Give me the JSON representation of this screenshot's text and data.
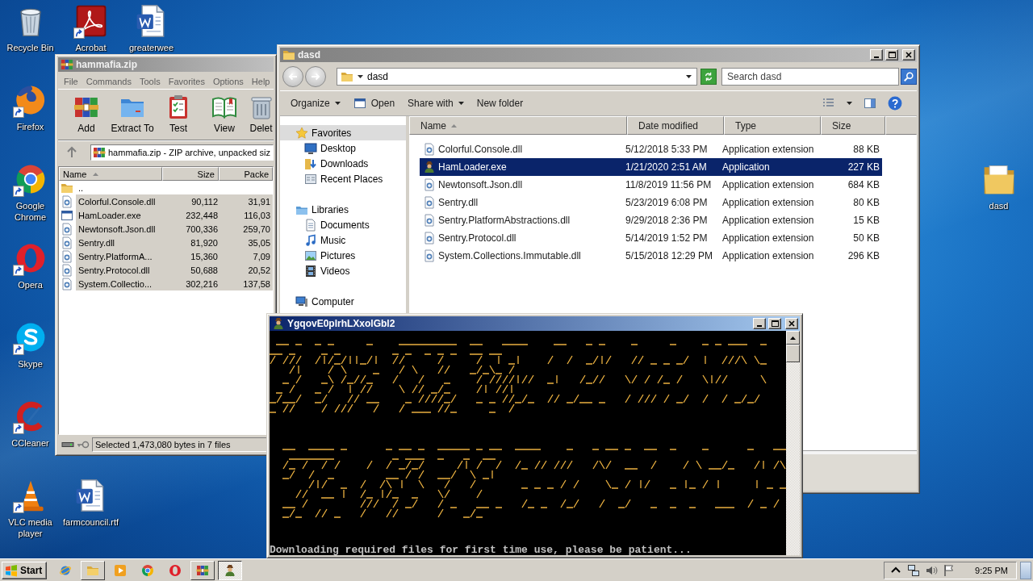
{
  "desktop": {
    "icons": [
      {
        "label": "Recycle Bin",
        "kind": "recycle-bin",
        "shortcut": false
      },
      {
        "label": "Acrobat",
        "kind": "acrobat",
        "shortcut": true
      },
      {
        "label": "greaterwee",
        "kind": "word-document",
        "shortcut": false
      },
      {
        "label": "Firefox",
        "kind": "firefox",
        "shortcut": true
      },
      {
        "label": "Google Chrome",
        "kind": "chrome",
        "shortcut": true
      },
      {
        "label": "Opera",
        "kind": "opera",
        "shortcut": true
      },
      {
        "label": "Skype",
        "kind": "skype",
        "shortcut": true
      },
      {
        "label": "CCleaner",
        "kind": "ccleaner",
        "shortcut": true
      },
      {
        "label": "VLC media player",
        "kind": "vlc",
        "shortcut": true
      },
      {
        "label": "farmcouncil.rtf",
        "kind": "word-document",
        "shortcut": false
      },
      {
        "label": "dasd",
        "kind": "folder",
        "shortcut": false
      }
    ]
  },
  "archive_window": {
    "title": "hammafia.zip",
    "active": false,
    "menu": [
      "File",
      "Commands",
      "Tools",
      "Favorites",
      "Options",
      "Help"
    ],
    "toolbar": [
      {
        "label": "Add",
        "kind": "add"
      },
      {
        "label": "Extract To",
        "kind": "extract"
      },
      {
        "label": "Test",
        "kind": "test"
      },
      {
        "label": "View",
        "kind": "view"
      },
      {
        "label": "Delet",
        "kind": "delete"
      }
    ],
    "path": "hammafia.zip - ZIP archive, unpacked siz",
    "columns": [
      {
        "label": "Name",
        "sorted": true
      },
      {
        "label": "Size",
        "sorted": false
      },
      {
        "label": "Packe",
        "sorted": false
      }
    ],
    "rows": [
      {
        "name": "..",
        "kind": "parent",
        "selected": false
      },
      {
        "name": "Colorful.Console.dll",
        "kind": "dll",
        "size": "90,112",
        "packed": "31,91",
        "selected": true
      },
      {
        "name": "HamLoader.exe",
        "kind": "exe",
        "size": "232,448",
        "packed": "116,03",
        "selected": true
      },
      {
        "name": "Newtonsoft.Json.dll",
        "kind": "dll",
        "size": "700,336",
        "packed": "259,70",
        "selected": true
      },
      {
        "name": "Sentry.dll",
        "kind": "dll",
        "size": "81,920",
        "packed": "35,05",
        "selected": true
      },
      {
        "name": "Sentry.PlatformA...",
        "kind": "dll",
        "size": "15,360",
        "packed": "7,09",
        "selected": true
      },
      {
        "name": "Sentry.Protocol.dll",
        "kind": "dll",
        "size": "50,688",
        "packed": "20,52",
        "selected": true
      },
      {
        "name": "System.Collectio...",
        "kind": "dll",
        "size": "302,216",
        "packed": "137,58",
        "selected": true
      }
    ],
    "status": "Selected 1,473,080 bytes in 7 files"
  },
  "explorer_window": {
    "title": "dasd",
    "active": false,
    "address": "dasd",
    "search": {
      "placeholder": "Search dasd"
    },
    "commands": [
      {
        "label": "Organize",
        "kind": "menu"
      },
      {
        "label": "Open",
        "kind": "open"
      },
      {
        "label": "Share with",
        "kind": "menu"
      },
      {
        "label": "New folder",
        "kind": "plain"
      }
    ],
    "navigation": [
      {
        "label": "Favorites",
        "kind": "favorites",
        "selected": true,
        "children": [
          {
            "label": "Desktop",
            "kind": "desktop",
            "selected": false
          },
          {
            "label": "Downloads",
            "kind": "downloads",
            "selected": false
          },
          {
            "label": "Recent Places",
            "kind": "recent",
            "selected": false
          }
        ]
      },
      {
        "label": "Libraries",
        "kind": "libraries",
        "selected": false,
        "children": [
          {
            "label": "Documents",
            "kind": "documents",
            "selected": false
          },
          {
            "label": "Music",
            "kind": "music",
            "selected": false
          },
          {
            "label": "Pictures",
            "kind": "pictures",
            "selected": false
          },
          {
            "label": "Videos",
            "kind": "videos",
            "selected": false
          }
        ]
      },
      {
        "label": "Computer",
        "kind": "computer",
        "selected": false
      }
    ],
    "columns": [
      {
        "label": "Name",
        "sorted": true
      },
      {
        "label": "Date modified",
        "sorted": false
      },
      {
        "label": "Type",
        "sorted": false
      },
      {
        "label": "Size",
        "sorted": false
      }
    ],
    "rows": [
      {
        "name": "Colorful.Console.dll",
        "kind": "dll",
        "date": "5/12/2018 5:33 PM",
        "type": "Application extension",
        "size": "88 KB",
        "selected": false
      },
      {
        "name": "HamLoader.exe",
        "kind": "exe",
        "date": "1/21/2020 2:51 AM",
        "type": "Application",
        "size": "227 KB",
        "selected": true
      },
      {
        "name": "Newtonsoft.Json.dll",
        "kind": "dll",
        "date": "11/8/2019 11:56 PM",
        "type": "Application extension",
        "size": "684 KB",
        "selected": false
      },
      {
        "name": "Sentry.dll",
        "kind": "dll",
        "date": "5/23/2019 6:08 PM",
        "type": "Application extension",
        "size": "80 KB",
        "selected": false
      },
      {
        "name": "Sentry.PlatformAbstractions.dll",
        "kind": "dll",
        "date": "9/29/2018 2:36 PM",
        "type": "Application extension",
        "size": "15 KB",
        "selected": false
      },
      {
        "name": "Sentry.Protocol.dll",
        "kind": "dll",
        "date": "5/14/2019 1:52 PM",
        "type": "Application extension",
        "size": "50 KB",
        "selected": false
      },
      {
        "name": "System.Collections.Immutable.dll",
        "kind": "dll",
        "date": "5/15/2018 12:29 PM",
        "type": "Application extension",
        "size": "296 KB",
        "selected": false
      }
    ]
  },
  "console_window": {
    "title": "YgqovE0plrhLXxolGbl2",
    "active": true,
    "message": "Downloading required files for first time use, please be patient..."
  },
  "taskbar": {
    "start": "Start",
    "buttons": [
      {
        "kind": "internet-explorer",
        "running": false,
        "selected": false
      },
      {
        "kind": "explorer",
        "running": true,
        "selected": false
      },
      {
        "kind": "media-player",
        "running": false,
        "selected": false
      },
      {
        "kind": "chrome",
        "running": false,
        "selected": false
      },
      {
        "kind": "opera",
        "running": false,
        "selected": false
      },
      {
        "kind": "winrar",
        "running": true,
        "selected": false
      },
      {
        "kind": "hamloader",
        "running": true,
        "selected": true
      }
    ],
    "tray": [
      {
        "kind": "show-hidden"
      },
      {
        "kind": "network"
      },
      {
        "kind": "volume"
      },
      {
        "kind": "flag"
      }
    ],
    "clock": "9:25 PM"
  }
}
